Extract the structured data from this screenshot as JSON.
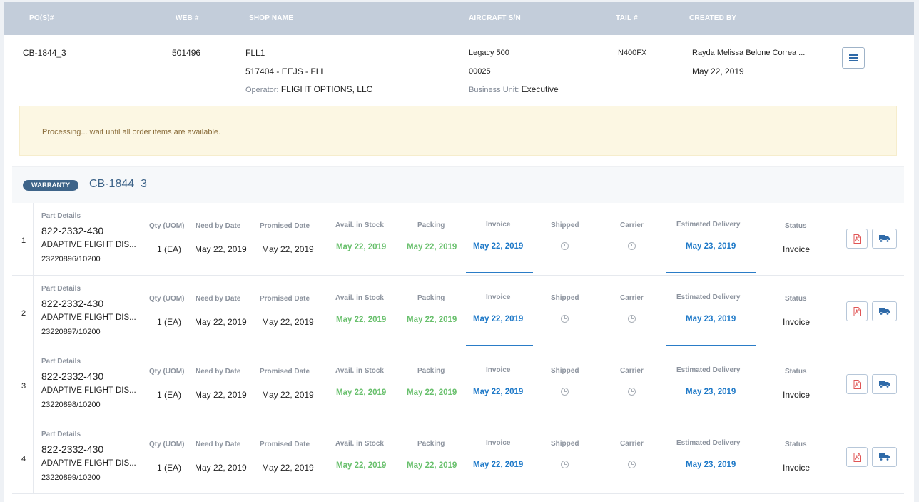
{
  "header": {
    "columns": {
      "pos": "PO(S)#",
      "web": "WEB #",
      "shop": "SHOP NAME",
      "aircraft": "AIRCRAFT S/N",
      "tail": "TAIL #",
      "created_by": "CREATED BY"
    }
  },
  "order": {
    "po": "CB-1844_3",
    "web": "501496",
    "shop_name": "FLL1",
    "shop_code": "517404 - EEJS - FLL",
    "operator_label": "Operator:",
    "operator": "FLIGHT OPTIONS, LLC",
    "aircraft_model": "Legacy 500",
    "aircraft_sn": "00025",
    "business_unit_label": "Business Unit:",
    "business_unit": "Executive",
    "tail": "N400FX",
    "created_by": "Rayda Melissa Belone Correa ...",
    "created_date": "May 22, 2019"
  },
  "alert": {
    "message": "Processing... wait until all order items are available."
  },
  "group": {
    "badge": "WARRANTY",
    "title": "CB-1844_3"
  },
  "item_labels": {
    "part_details": "Part Details",
    "qty": "Qty (UOM)",
    "need_by": "Need by Date",
    "promised": "Promised Date",
    "avail": "Avail. in Stock",
    "packing": "Packing",
    "invoice": "Invoice",
    "shipped": "Shipped",
    "carrier": "Carrier",
    "est_delivery": "Estimated Delivery",
    "status": "Status"
  },
  "items": [
    {
      "num": "1",
      "part": "822-2332-430",
      "desc": "ADAPTIVE FLIGHT DIS...",
      "ref": "23220896/10200",
      "qty": "1 (EA)",
      "need_by": "May 22, 2019",
      "promised": "May 22, 2019",
      "avail": "May 22, 2019",
      "packing": "May 22, 2019",
      "invoice": "May 22, 2019",
      "est_delivery": "May 23, 2019",
      "status": "Invoice"
    },
    {
      "num": "2",
      "part": "822-2332-430",
      "desc": "ADAPTIVE FLIGHT DIS...",
      "ref": "23220897/10200",
      "qty": "1 (EA)",
      "need_by": "May 22, 2019",
      "promised": "May 22, 2019",
      "avail": "May 22, 2019",
      "packing": "May 22, 2019",
      "invoice": "May 22, 2019",
      "est_delivery": "May 23, 2019",
      "status": "Invoice"
    },
    {
      "num": "3",
      "part": "822-2332-430",
      "desc": "ADAPTIVE FLIGHT DIS...",
      "ref": "23220898/10200",
      "qty": "1 (EA)",
      "need_by": "May 22, 2019",
      "promised": "May 22, 2019",
      "avail": "May 22, 2019",
      "packing": "May 22, 2019",
      "invoice": "May 22, 2019",
      "est_delivery": "May 23, 2019",
      "status": "Invoice"
    },
    {
      "num": "4",
      "part": "822-2332-430",
      "desc": "ADAPTIVE FLIGHT DIS...",
      "ref": "23220899/10200",
      "qty": "1 (EA)",
      "need_by": "May 22, 2019",
      "promised": "May 22, 2019",
      "avail": "May 22, 2019",
      "packing": "May 22, 2019",
      "invoice": "May 22, 2019",
      "est_delivery": "May 23, 2019",
      "status": "Invoice"
    }
  ],
  "icons": {
    "list": "list-icon",
    "pdf": "pdf-icon",
    "truck": "truck-icon",
    "clock": "clock-icon"
  },
  "colors": {
    "header_bg": "#c3cdda",
    "alert_bg": "#fcf7e3",
    "alert_text": "#8a6d3b",
    "badge": "#3e6489",
    "green": "#69c06d",
    "blue": "#1e79c8",
    "pdf_red": "#e05555",
    "truck_blue": "#2f6aa8"
  }
}
